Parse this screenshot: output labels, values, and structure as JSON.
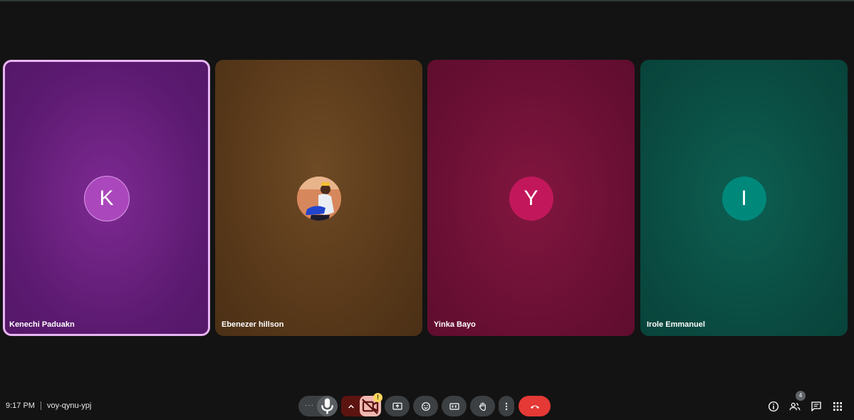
{
  "participants": [
    {
      "name": "Kenechi Paduakn",
      "initial": "K",
      "active": true
    },
    {
      "name": "Ebenezer hillson",
      "initial": "",
      "photo": "person-photo"
    },
    {
      "name": "Yinka Bayo",
      "initial": "Y"
    },
    {
      "name": "Irole Emmanuel",
      "initial": "I"
    }
  ],
  "meeting": {
    "time": "9:17 PM",
    "code": "voy-qynu-ypj"
  },
  "controls": {
    "more_dots": "···",
    "camera_warning": "!",
    "people_count": "4"
  },
  "icons": {
    "mic": "mic-icon",
    "caret": "chevron-up-icon",
    "camera_off": "videocam-off-icon",
    "present": "present-screen-icon",
    "emoji": "emoji-icon",
    "captions": "closed-captions-icon",
    "raise_hand": "raise-hand-icon",
    "more": "more-vert-icon",
    "leave": "call-end-icon",
    "info": "info-icon",
    "people": "people-icon",
    "chat": "chat-icon",
    "apps": "apps-grid-icon"
  },
  "colors": {
    "background": "#131313",
    "tile_purple": "#5b1a70",
    "tile_brown": "#553618",
    "tile_crimson": "#680f33",
    "tile_teal": "#0a4a40",
    "active_border": "#e7b6f2",
    "leave_red": "#e53935",
    "camera_off_bg": "#f1b8b2"
  }
}
